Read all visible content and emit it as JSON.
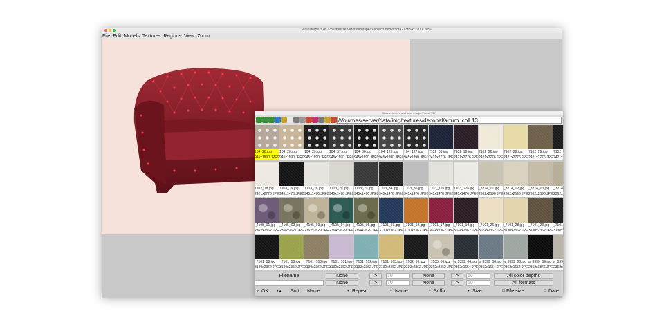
{
  "window": {
    "title": "ArahDrape 3.0c /Volumes/server/data/drape/drape.os demo/sofa2 (3654x1900) 50%",
    "menu": [
      "File",
      "Edit",
      "Models",
      "Textures",
      "Regions",
      "View",
      "Zoom"
    ]
  },
  "colors": {
    "canvas": "#f6e2db",
    "sofa": "#8c1f2a",
    "selection": "#ffff00",
    "accent": "#4caf50"
  },
  "browser": {
    "title": "Browse texture and save image: Found 137",
    "path": "/Volumes/server/data/img/textures/decobel/arturo_coll.13",
    "toolbar_icons": [
      "back-icon",
      "forward-icon",
      "up-icon",
      "reload-icon",
      "home-icon",
      "new-folder-icon",
      "print-icon",
      "list-icon",
      "trash-icon",
      "edit-icon",
      "copy-icon",
      "folder-icon",
      "info-icon"
    ],
    "rows": [
      [
        {
          "name": "104_26.jpg",
          "dim": "945x1890 JPEG",
          "color": "#b7a89c",
          "pattern": "dots"
        },
        {
          "name": "104_26.jpg",
          "dim": "945x1890 JPEG",
          "color": "#c8b79a",
          "pattern": "dots"
        },
        {
          "name": "104_29.jpg",
          "dim": "945x1890 JPEG",
          "color": "#202020",
          "pattern": "dots"
        },
        {
          "name": "104_37.jpg",
          "dim": "945x1890 JPEG",
          "color": "#3a3a3a",
          "pattern": "dots"
        },
        {
          "name": "104_36.jpg",
          "dim": "945x1890 JPEG",
          "color": "#1a1a1a",
          "pattern": "dots"
        },
        {
          "name": "104_126.jpg",
          "dim": "945x1890 JPEG",
          "color": "#474747",
          "pattern": "dots"
        },
        {
          "name": "104_127.jpg",
          "dim": "945x1890 JPEG",
          "color": "#2a2a2a",
          "pattern": "dots"
        },
        {
          "name": "7102_03.jpg",
          "dim": "2421x2776 JPEG",
          "color": "#1e2438",
          "pattern": "plain"
        },
        {
          "name": "7102_19.jpg",
          "dim": "2421x2776 JPEG",
          "color": "#2b1e26",
          "pattern": "plain"
        },
        {
          "name": "7102_26.jpg",
          "dim": "2421x2776 JPEG",
          "color": "#efe9d9",
          "pattern": "plain"
        },
        {
          "name": "7102_29.jpg",
          "dim": "2421x2776 JPEG",
          "color": "#e8dba8",
          "pattern": "plain"
        },
        {
          "name": "7102_29.jpg",
          "dim": "2421x2776 JPEG",
          "color": "#6e6049",
          "pattern": "plain"
        },
        {
          "name": "7102_3",
          "dim": "2421x2",
          "color": "#1b1b1b",
          "pattern": "plain"
        }
      ],
      [
        {
          "name": "7102_18.jpg",
          "dim": "2421x2776 JPEG",
          "color": "#ede9e1",
          "pattern": "plain"
        },
        {
          "name": "7103_19.jpg",
          "dim": "945x1476 JPEG",
          "color": "#151515",
          "pattern": "plain"
        },
        {
          "name": "7103_26.jpg",
          "dim": "945x1476 JPEG",
          "color": "#e6e4df",
          "pattern": "plain"
        },
        {
          "name": "7103_29.jpg",
          "dim": "945x1476 JPEG",
          "color": "#d9d6cf",
          "pattern": "plain"
        },
        {
          "name": "7103_29.jpg",
          "dim": "945x1476 JPEG",
          "color": "#3a3a3a",
          "pattern": "plain"
        },
        {
          "name": "7103_34.jpg",
          "dim": "945x1476 JPEG",
          "color": "#262626",
          "pattern": "plain"
        },
        {
          "name": "7103_36.jpg",
          "dim": "945x1476 JPEG",
          "color": "#bdbdbd",
          "pattern": "plain"
        },
        {
          "name": "7103_126.jpg",
          "dim": "945x1476 JPEG",
          "color": "#e3e1dc",
          "pattern": "plain"
        },
        {
          "name": "7103_226.jpg",
          "dim": "945x1476 JPEG",
          "color": "#ebe9e4",
          "pattern": "plain"
        },
        {
          "name": "_3214_01.jpg",
          "dim": "2362x2596 JPEG",
          "color": "#c9c3b3",
          "pattern": "plain"
        },
        {
          "name": "_3214_02.jpg",
          "dim": "2362x2596 JPEG",
          "color": "#d8d1bd",
          "pattern": "plain"
        },
        {
          "name": "_3214_03.jpg",
          "dim": "2362x2596 JPEG",
          "color": "#c3bba6",
          "pattern": "plain"
        },
        {
          "name": "_3214",
          "dim": "2362x2",
          "color": "#b7ae98",
          "pattern": "plain"
        }
      ],
      [
        {
          "name": "_4105_01.jpg",
          "dim": "2362x2362 JPEG",
          "color": "#6e5c7a",
          "pattern": "paisley"
        },
        {
          "name": "_4105_02.jpg",
          "dim": "2356x2627 JPEG",
          "color": "#7a7560",
          "pattern": "paisley"
        },
        {
          "name": "_4105_03.jpg",
          "dim": "2362x2629 JPEG",
          "color": "#bfb39a",
          "pattern": "paisley"
        },
        {
          "name": "_4105_04.jpg",
          "dim": "2364x2629 JPEG",
          "color": "#2f5c54",
          "pattern": "paisley"
        },
        {
          "name": "_4105_05.jpg",
          "dim": "2364x2629 JPEG",
          "color": "#6d6c4f",
          "pattern": "paisley"
        },
        {
          "name": "_7101_03.jpg",
          "dim": "3130x2362 JPEG",
          "color": "#243a5a",
          "pattern": "plain"
        },
        {
          "name": "_7101_12.jpg",
          "dim": "3130x2362 JPEG",
          "color": "#c5742c",
          "pattern": "plain"
        },
        {
          "name": "_7101_17.jpg",
          "dim": "3074x2362 JPEG",
          "color": "#8a1f3e",
          "pattern": "plain"
        },
        {
          "name": "_7101_19.jpg",
          "dim": "3074x2362 JPEG",
          "color": "#2c1d24",
          "pattern": "plain"
        },
        {
          "name": "_7101_26.jpg",
          "dim": "3074x2362 JPEG",
          "color": "#ecdfc3",
          "pattern": "plain"
        },
        {
          "name": "_7101_28.jpg",
          "dim": "3130x2362 JPEG",
          "color": "#e4d6ae",
          "pattern": "plain"
        },
        {
          "name": "_7101_29.jpg",
          "dim": "3130x2362 JPEG",
          "color": "#5f5340",
          "pattern": "plain"
        },
        {
          "name": "_7101",
          "dim": "3130x2",
          "color": "#1c1c1c",
          "pattern": "plain"
        }
      ],
      [
        {
          "name": "_7101_38.jpg",
          "dim": "3130x2362 JPEG",
          "color": "#151515",
          "pattern": "plain"
        },
        {
          "name": "_7101_50.jpg",
          "dim": "3130x2362 JPEG",
          "color": "#9aa24a",
          "pattern": "plain"
        },
        {
          "name": "_7101_100.jpg",
          "dim": "3130x2362 JPEG",
          "color": "#8d7f63",
          "pattern": "plain"
        },
        {
          "name": "_7101_101.jpg",
          "dim": "3130x2362 JPEG",
          "color": "#c9b9d1",
          "pattern": "plain"
        },
        {
          "name": "_7101_102.jpg",
          "dim": "3130x2362 JPEG",
          "color": "#7fb0b3",
          "pattern": "plain"
        },
        {
          "name": "_7101_103.jpg",
          "dim": "3130x2362 JPEG",
          "color": "#d1b978",
          "pattern": "plain"
        },
        {
          "name": "_7102_38.jpg",
          "dim": "2330x2362 JPEG",
          "color": "#1a1a1a",
          "pattern": "plain"
        },
        {
          "name": "_7105_06.jpg",
          "dim": "2362x2362 JPEG",
          "color": "#cac3b4",
          "pattern": "paisley"
        },
        {
          "name": "a_3399_04.jpg",
          "dim": "2362x1654 JPEG",
          "color": "#2a2f36",
          "pattern": "plain"
        },
        {
          "name": "a_3399_06.jpg",
          "dim": "2362x1654 JPEG",
          "color": "#6c7a86",
          "pattern": "plain"
        },
        {
          "name": "a_3399_08.jpg",
          "dim": "2362x1654 JPEG",
          "color": "#9fa6a1",
          "pattern": "plain"
        },
        {
          "name": "a_3399_09.jpg",
          "dim": "2362x1846 JPEG",
          "color": "#0d0d0d",
          "pattern": "plain"
        },
        {
          "name": "a_3399",
          "dim": "2362x1",
          "color": "#b9b4a8",
          "pattern": "plain"
        }
      ]
    ],
    "controls": {
      "filename_label": "Filename",
      "none1": "None",
      "none2": "None",
      "none3": "None",
      "none4": "None",
      "arrow1": ">",
      "arrow2": ">",
      "arrow3": ">",
      "arrow4": ">",
      "ten1": "10",
      "ten2": "10",
      "ten3": "10",
      "ten4": "10",
      "color_depths": "All color depths",
      "formats": "All formats",
      "ok": "OK",
      "sort": "Sort",
      "name": "Name",
      "repeat": "Repeat",
      "name2": "Name",
      "suffix": "Suffix",
      "size": "Size",
      "file_size": "File size",
      "date": "Date"
    }
  }
}
